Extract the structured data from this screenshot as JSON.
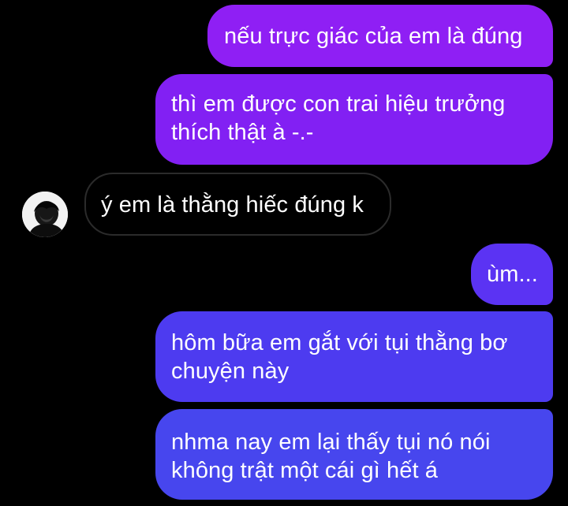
{
  "conversation": {
    "messages": [
      {
        "sender": "me",
        "lines": [
          "nếu trực giác của em là đúng"
        ]
      },
      {
        "sender": "me",
        "lines": [
          "thì em được con trai hiệu trưởng",
          "thích thật à -.-"
        ]
      },
      {
        "sender": "other",
        "lines": [
          "ý em là thằng hiếc đúng k"
        ]
      },
      {
        "sender": "me",
        "lines": [
          "ùm..."
        ]
      },
      {
        "sender": "me",
        "lines": [
          "hôm bữa em gắt với tụi thằng bơ",
          "chuyện này"
        ]
      },
      {
        "sender": "me",
        "lines": [
          "nhma nay em lại thấy tụi nó nói",
          "không trật một cái gì hết á"
        ]
      }
    ]
  },
  "colors": {
    "background": "#000000",
    "bubble_1": "#8f1ff4",
    "bubble_2": "#8220f3",
    "bubble_incoming_border": "#2b2b2b",
    "bubble_4": "#5b33f3",
    "bubble_5": "#4d3bf0",
    "bubble_6": "#4746ee",
    "text": "#ffffff"
  },
  "icons": {
    "avatar": "profile-avatar-icon"
  }
}
